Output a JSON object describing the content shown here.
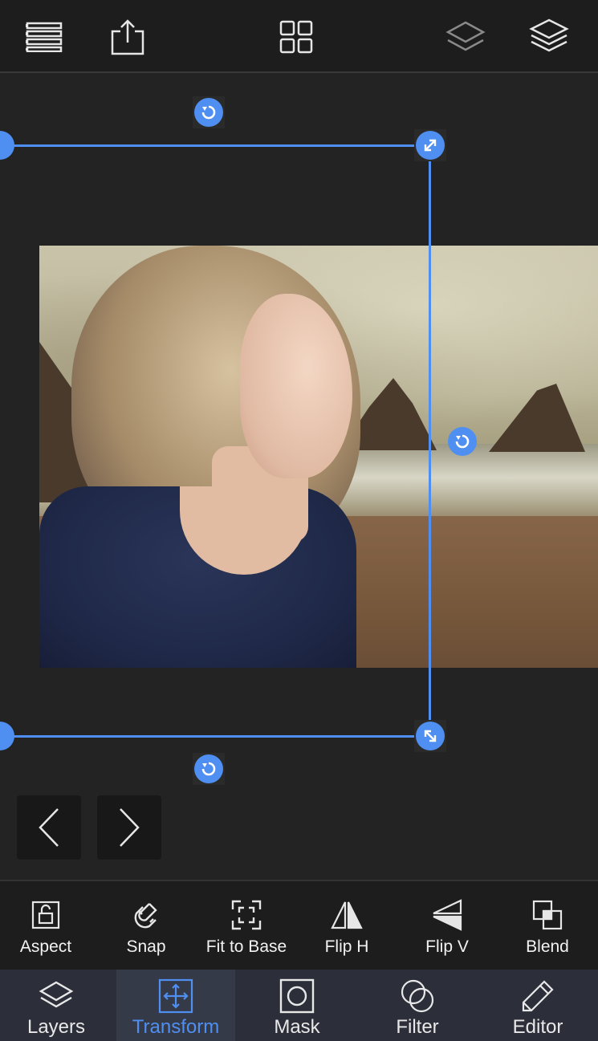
{
  "topbar": {
    "icons": [
      "list-icon",
      "share-icon",
      "grid-icon",
      "layers-single-icon",
      "layers-stack-icon"
    ]
  },
  "tools": [
    {
      "label": "Aspect",
      "icon": "lock-icon"
    },
    {
      "label": "Snap",
      "icon": "magnet-icon"
    },
    {
      "label": "Fit to Base",
      "icon": "fit-frame-icon"
    },
    {
      "label": "Flip H",
      "icon": "flip-horizontal-icon"
    },
    {
      "label": "Flip V",
      "icon": "flip-vertical-icon"
    },
    {
      "label": "Blend",
      "icon": "blend-icon"
    }
  ],
  "tabs": [
    {
      "label": "Layers",
      "icon": "layers-icon",
      "active": false
    },
    {
      "label": "Transform",
      "icon": "transform-icon",
      "active": true
    },
    {
      "label": "Mask",
      "icon": "mask-icon",
      "active": false
    },
    {
      "label": "Filter",
      "icon": "filter-icon",
      "active": false
    },
    {
      "label": "Editor",
      "icon": "pencil-icon",
      "active": false
    }
  ],
  "colors": {
    "accent": "#4f8ff1",
    "background": "#232323",
    "tabbar": "#2c2f3a"
  }
}
